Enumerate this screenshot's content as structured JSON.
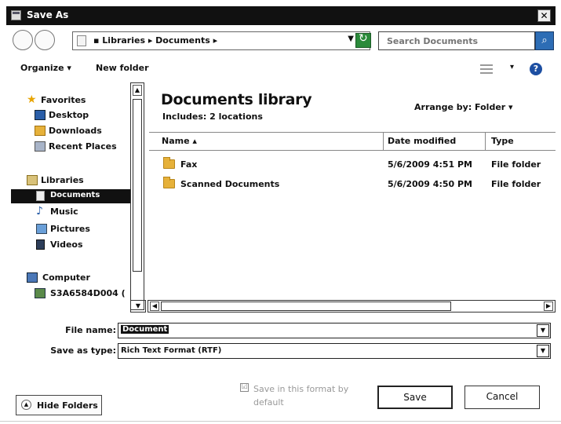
{
  "window": {
    "title": "Save As",
    "close_glyph": "✕"
  },
  "address": {
    "breadcrumb": "▪ Libraries ▸ Documents ▸",
    "dropdown_glyph": "▼"
  },
  "search": {
    "placeholder": "Search Documents"
  },
  "toolbar": {
    "organize": "Organize ▾",
    "new_folder": "New folder",
    "view_dropdown": "▾",
    "help": "?"
  },
  "nav": {
    "items": [
      {
        "label": "Favorites",
        "icon": "star-icon"
      },
      {
        "label": "Desktop",
        "icon": "desktop-icon"
      },
      {
        "label": "Downloads",
        "icon": "downloads-icon"
      },
      {
        "label": "Recent Places",
        "icon": "recent-places-icon"
      },
      {
        "label": "Libraries",
        "icon": "libraries-icon"
      },
      {
        "label": "Documents",
        "icon": "documents-icon",
        "selected": true
      },
      {
        "label": "Music",
        "icon": "music-icon"
      },
      {
        "label": "Pictures",
        "icon": "pictures-icon"
      },
      {
        "label": "Videos",
        "icon": "videos-icon"
      },
      {
        "label": "Computer",
        "icon": "computer-icon"
      },
      {
        "label": "S3A6584D004 (",
        "icon": "drive-icon"
      }
    ]
  },
  "library": {
    "title": "Documents library",
    "subtitle": "Includes: 2 locations",
    "arrange_by": "Arrange by:  Folder ▾"
  },
  "columns": [
    "Name ▴",
    "Date modified",
    "Type"
  ],
  "files": [
    {
      "name": "Fax",
      "date": "5/6/2009 4:51 PM",
      "type": "File folder"
    },
    {
      "name": "Scanned Documents",
      "date": "5/6/2009 4:50 PM",
      "type": "File folder"
    }
  ],
  "form": {
    "file_name_label": "File name:",
    "file_name_value": "Document",
    "save_type_label": "Save as type:",
    "save_type_value": "Rich Text Format (RTF)"
  },
  "footer": {
    "hide_folders": "Hide Folders",
    "checkbox_label": "Save in this format by default",
    "save": "Save",
    "cancel": "Cancel"
  }
}
